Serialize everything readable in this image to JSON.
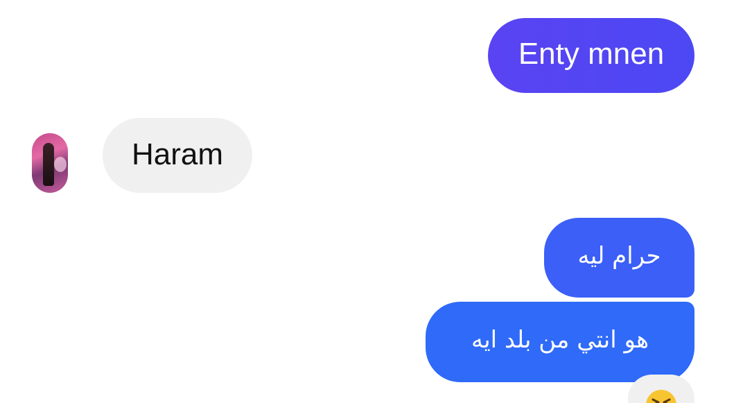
{
  "messages": [
    {
      "direction": "outgoing",
      "text": "Enty mnen",
      "color": "#5246f3"
    },
    {
      "direction": "incoming",
      "text": "Haram",
      "color": "#f0f0f0"
    },
    {
      "direction": "outgoing",
      "text": "حرام ليه",
      "color": "#3b5ff7"
    },
    {
      "direction": "outgoing",
      "text": "هو انتي من بلد ايه",
      "color": "#2f6af8"
    }
  ],
  "reaction": {
    "icon": "laughing-squint-face-emoji"
  },
  "avatar": {
    "icon": "contact-profile-photo"
  }
}
